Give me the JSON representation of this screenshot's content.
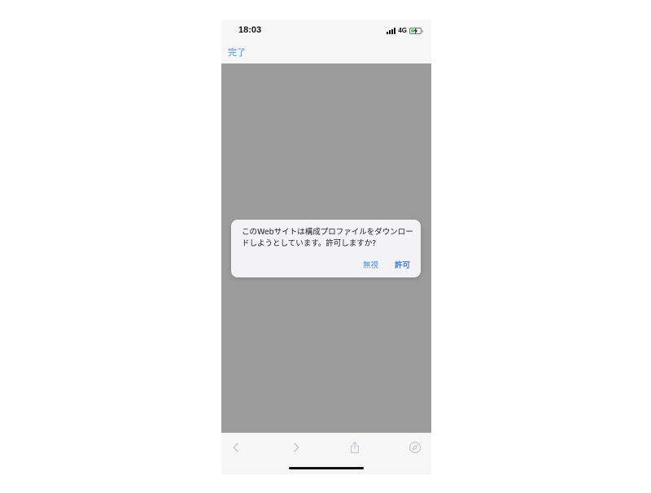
{
  "status_bar": {
    "time": "18:03",
    "network": "4G",
    "battery_level": 0.35,
    "battery_charging": true,
    "battery_color": "#4cd964"
  },
  "nav": {
    "done_label": "完了"
  },
  "alert": {
    "message": "このWebサイトは構成プロファイルをダウンロードしようとしています。許可しますか?",
    "ignore_label": "無視",
    "allow_label": "許可"
  },
  "toolbar": {
    "icons": [
      "back-icon",
      "forward-icon",
      "share-icon",
      "compass-icon"
    ],
    "icon_color": "#c7c7cc"
  },
  "colors": {
    "accent": "#4a90e2",
    "overlay": "#9b9b9b",
    "chrome": "#f6f6f6"
  }
}
